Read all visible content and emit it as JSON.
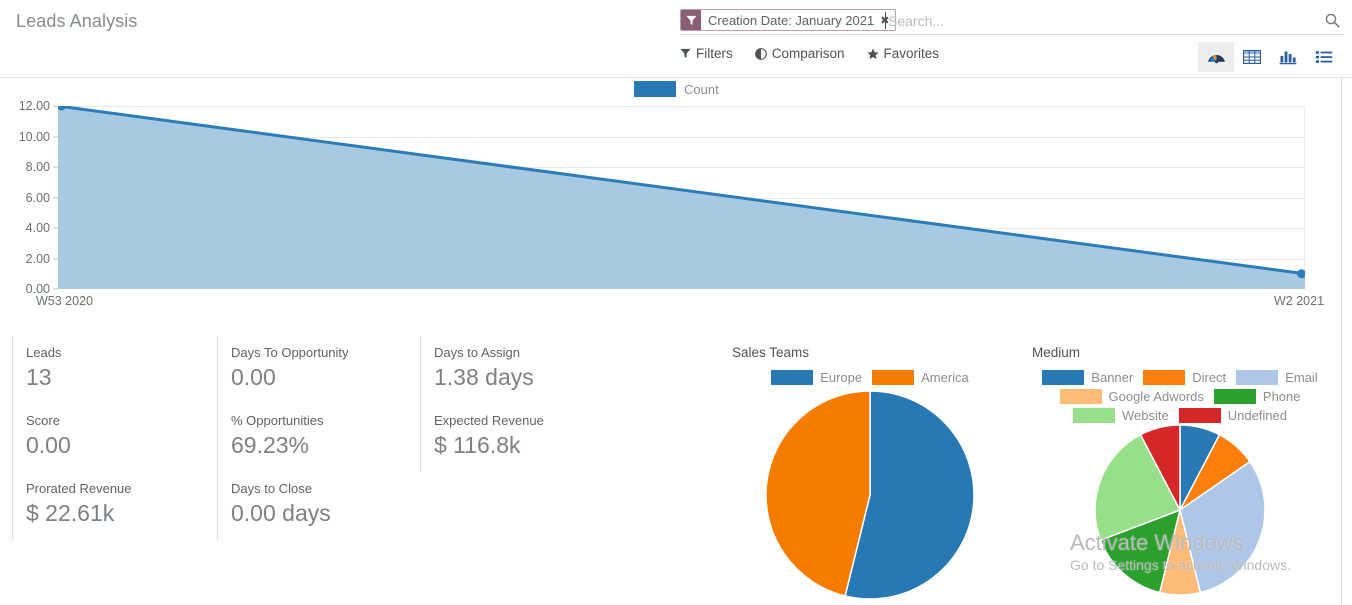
{
  "header": {
    "title": "Leads Analysis",
    "search": {
      "facet_label": "Creation Date: January 2021",
      "facet_icon": "filter-icon",
      "facet_close_glyph": "✖",
      "placeholder": "Search...",
      "value": "",
      "magnifier_icon": "search-icon"
    },
    "toolbar": {
      "filters_label": "Filters",
      "filters_icon": "filter-icon",
      "comparison_label": "Comparison",
      "comparison_icon": "half-circle-icon",
      "favorites_label": "Favorites",
      "favorites_icon": "star-icon"
    },
    "views": [
      {
        "name": "dashboard",
        "icon": "gauge-icon",
        "active": true
      },
      {
        "name": "pivot",
        "icon": "table-icon",
        "active": false
      },
      {
        "name": "graph",
        "icon": "bar-chart-icon",
        "active": false
      },
      {
        "name": "list",
        "icon": "list-icon",
        "active": false
      }
    ]
  },
  "colors": {
    "accent_blue": "#2878b4",
    "area_fill": "#a7c9e2",
    "area_line": "#2b7cb8",
    "orange": "#f57c00",
    "light_blue": "#aec7e8",
    "light_orange": "#ffbb78",
    "green": "#2ca02c",
    "light_green": "#98df8a",
    "red": "#d62728",
    "facet_purple": "#8b5e75",
    "text_grey": "#7d8184"
  },
  "chart_data": [
    {
      "type": "area",
      "title": "",
      "legend": [
        {
          "label": "Count",
          "color": "#2878b4"
        }
      ],
      "legend_position": "top-center",
      "x": [
        "W53 2020",
        "W2 2021"
      ],
      "categories": [
        "W53 2020",
        "W2 2021"
      ],
      "series": [
        {
          "name": "Count",
          "values": [
            12,
            1
          ]
        }
      ],
      "values": [
        12,
        1
      ],
      "xlabel": "",
      "ylabel": "",
      "ylim": [
        0,
        12
      ],
      "yticks": [
        "0.00",
        "2.00",
        "4.00",
        "6.00",
        "8.00",
        "10.00",
        "12.00"
      ],
      "ytick_values": [
        0,
        2,
        4,
        6,
        8,
        10,
        12
      ],
      "grid": true
    },
    {
      "type": "pie",
      "title": "Sales Teams",
      "labels": [
        "Europe",
        "America"
      ],
      "values": [
        7,
        6
      ],
      "percents": [
        53.8,
        46.2
      ],
      "colors": [
        "#2878b4",
        "#f57c00"
      ],
      "legend_position": "top"
    },
    {
      "type": "pie",
      "title": "Medium",
      "labels": [
        "Banner",
        "Direct",
        "Email",
        "Google Adwords",
        "Phone",
        "Website",
        "Undefined"
      ],
      "values": [
        1,
        1,
        4,
        1,
        2,
        3,
        1
      ],
      "percents": [
        7.7,
        7.7,
        30.8,
        7.7,
        15.4,
        23.1,
        7.7
      ],
      "colors": [
        "#2878b4",
        "#ff7f0e",
        "#aec7e8",
        "#ffbb78",
        "#2ca02c",
        "#98df8a",
        "#d62728"
      ],
      "legend_position": "top"
    }
  ],
  "tiles": [
    [
      {
        "label": "Leads",
        "value": "13"
      },
      {
        "label": "Days To Opportunity",
        "value": "0.00"
      },
      {
        "label": "Days to Assign",
        "value": "1.38 days"
      }
    ],
    [
      {
        "label": "Score",
        "value": "0.00"
      },
      {
        "label": "% Opportunities",
        "value": "69.23%"
      },
      {
        "label": "Expected Revenue",
        "value": "$ 116.8k"
      }
    ],
    [
      {
        "label": "Prorated Revenue",
        "value": "$ 22.61k"
      },
      {
        "label": "Days to Close",
        "value": "0.00 days"
      },
      {
        "label": "",
        "value": ""
      }
    ]
  ],
  "watermark": {
    "line1": "Activate Windows",
    "line2": "Go to Settings to activate Windows."
  }
}
